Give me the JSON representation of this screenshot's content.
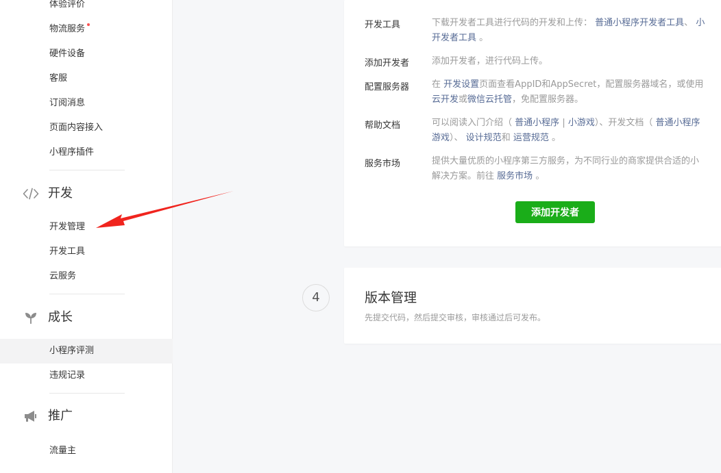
{
  "sidebar": {
    "items_top": [
      {
        "label": "体验评价"
      },
      {
        "label": "物流服务"
      },
      {
        "label": "硬件设备"
      },
      {
        "label": "客服"
      },
      {
        "label": "订阅消息"
      },
      {
        "label": "页面内容接入"
      },
      {
        "label": "小程序插件"
      }
    ],
    "groups": {
      "dev": {
        "title": "开发",
        "items": [
          {
            "label": "开发管理"
          },
          {
            "label": "开发工具"
          },
          {
            "label": "云服务"
          }
        ]
      },
      "growth": {
        "title": "成长",
        "items": [
          {
            "label": "小程序评测"
          },
          {
            "label": "违规记录"
          }
        ]
      },
      "promote": {
        "title": "推广",
        "items": [
          {
            "label": "流量主"
          }
        ]
      }
    },
    "active_item": "小程序评测"
  },
  "step3": {
    "rows": {
      "tools": {
        "label": "开发工具",
        "line1": "下载开发者工具进行代码的开发和上传：",
        "link1": "普通小程序开发者工具",
        "sep": "、",
        "link1b": "小",
        "link2": "开发者工具",
        "end": "。"
      },
      "add_dev": {
        "label": "添加开发者",
        "text": "添加开发者，进行代码上传。"
      },
      "server": {
        "label": "配置服务器",
        "pre": "在",
        "link1": "开发设置",
        "mid": "页面查看AppID和AppSecret，配置服务器域名，或使用",
        "link2": "云开发",
        "or": "或",
        "link3": "微信云托管",
        "post": "，免配置服务器。"
      },
      "help": {
        "label": "帮助文档",
        "pre": "可以阅读入门介绍（",
        "link1": "普通小程序",
        "bar": "|",
        "link2": "小游戏",
        "mid": "）、开发文档（",
        "link3": "普通小程序",
        "link4": "游戏",
        "mid2": "）、",
        "link5": "设计规范",
        "and": "和",
        "link6": "运营规范",
        "end": "。"
      },
      "market": {
        "label": "服务市场",
        "line1": "提供大量优质的小程序第三方服务，为不同行业的商家提供合适的小",
        "line2pre": "解决方案。前往",
        "link": "服务市场",
        "end": "。"
      }
    },
    "button_label": "添加开发者"
  },
  "step4": {
    "number": "4",
    "title": "版本管理",
    "subtitle": "先提交代码，然后提交审核，审核通过后可发布。"
  },
  "colors": {
    "primary_green": "#1aad19",
    "link_blue": "#576b95",
    "annotation_red": "#f0241e",
    "notice_dot": "#fa5151"
  }
}
